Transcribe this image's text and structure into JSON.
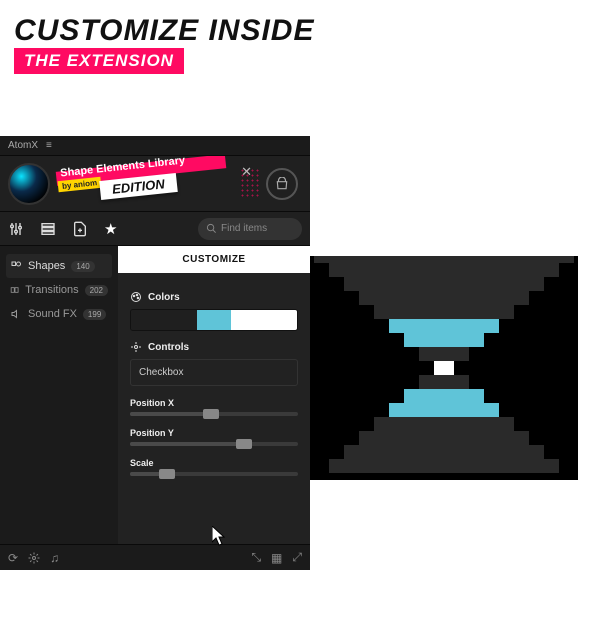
{
  "heading": {
    "line1": "CUSTOMIZE INSIDE",
    "line2": "THE EXTENSION"
  },
  "app": {
    "titlebar": "AtomX",
    "banner": {
      "title": "Shape Elements Library",
      "by": "by aniom",
      "edition": "EDITION"
    },
    "search": {
      "placeholder": "Find items"
    },
    "sidebar": {
      "items": [
        {
          "label": "Shapes",
          "count": "140"
        },
        {
          "label": "Transitions",
          "count": "202"
        },
        {
          "label": "Sound FX",
          "count": "199"
        }
      ]
    },
    "main": {
      "tab": "CUSTOMIZE",
      "colors_label": "Colors",
      "swatches": [
        "#1f1f1f",
        "#1f1f1f",
        "#5fc4d8",
        "#ffffff",
        "#ffffff"
      ],
      "controls_label": "Controls",
      "checkbox_label": "Checkbox",
      "sliders": [
        {
          "label": "Position X",
          "pos": 48
        },
        {
          "label": "Position Y",
          "pos": 68
        },
        {
          "label": "Scale",
          "pos": 22
        }
      ]
    }
  }
}
